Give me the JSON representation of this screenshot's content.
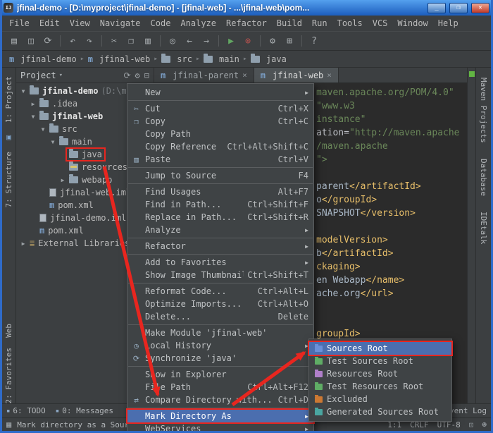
{
  "colors": {
    "selection": "#4b6eaf",
    "annotation_red": "#e8261f",
    "inspection_ok_green": "#62b543"
  },
  "window": {
    "title": "jfinal-demo - [D:\\myproject\\jfinal-demo] - [jfinal-web] - ...\\jfinal-web\\pom...",
    "app_icon": "IJ",
    "minimize": "_",
    "maximize": "❐",
    "close": "✕"
  },
  "menubar": {
    "items": [
      "File",
      "Edit",
      "View",
      "Navigate",
      "Code",
      "Analyze",
      "Refactor",
      "Build",
      "Run",
      "Tools",
      "VCS",
      "Window",
      "Help"
    ]
  },
  "toolbar": {
    "icons": [
      {
        "name": "open-icon",
        "glyph": "▤"
      },
      {
        "name": "save-all-icon",
        "glyph": "◫"
      },
      {
        "name": "synchronize-icon",
        "glyph": "⟳"
      },
      {
        "name": "sep"
      },
      {
        "name": "undo-icon",
        "glyph": "↶"
      },
      {
        "name": "redo-icon",
        "glyph": "↷"
      },
      {
        "name": "sep"
      },
      {
        "name": "cut-icon",
        "glyph": "✂"
      },
      {
        "name": "copy-icon",
        "glyph": "❐"
      },
      {
        "name": "paste-icon",
        "glyph": "▥"
      },
      {
        "name": "sep"
      },
      {
        "name": "find-icon",
        "glyph": "◎"
      },
      {
        "name": "back-icon",
        "glyph": "←"
      },
      {
        "name": "forward-icon",
        "glyph": "→"
      },
      {
        "name": "sep"
      },
      {
        "name": "run-icon",
        "glyph": "▶",
        "color": "#62a662"
      },
      {
        "name": "debug-icon",
        "glyph": "⊙",
        "color": "#c75450"
      },
      {
        "name": "sep"
      },
      {
        "name": "settings-icon",
        "glyph": "⚙"
      },
      {
        "name": "project-structure-icon",
        "glyph": "⊞"
      },
      {
        "name": "sep"
      },
      {
        "name": "help-icon",
        "glyph": "?"
      }
    ]
  },
  "breadcrumbs": {
    "separator": "▸",
    "items": [
      {
        "label": "jfinal-demo",
        "icon": "module"
      },
      {
        "label": "jfinal-web",
        "icon": "module"
      },
      {
        "label": "src",
        "icon": "folder"
      },
      {
        "label": "main",
        "icon": "folder"
      },
      {
        "label": "java",
        "icon": "folder"
      }
    ]
  },
  "left_strip": {
    "top": [
      {
        "label": "1: Project"
      },
      {
        "icon": "▣"
      },
      {
        "label": "7: Structure"
      }
    ],
    "bottom": [
      {
        "label": "Web"
      },
      {
        "label": "2: Favorites"
      }
    ]
  },
  "right_strip": {
    "items": [
      "Maven Projects",
      "Database",
      "IDEtalk"
    ]
  },
  "project_panel": {
    "title": "Project",
    "caret": "▾",
    "header_icons": [
      {
        "name": "sync-icon",
        "glyph": "⟳"
      },
      {
        "name": "gear-icon",
        "glyph": "⚙"
      },
      {
        "name": "collapse-all-icon",
        "glyph": "⊟"
      }
    ],
    "tree": [
      {
        "label": "jfinal-demo",
        "suffix": "(D:\\mypr",
        "depth": 0,
        "arrow": "open",
        "icon": "folder",
        "bold": true
      },
      {
        "label": ".idea",
        "depth": 1,
        "arrow": "closed",
        "icon": "folder"
      },
      {
        "label": "jfinal-web",
        "depth": 1,
        "arrow": "open",
        "icon": "folder",
        "bold": true
      },
      {
        "label": "src",
        "depth": 2,
        "arrow": "open",
        "icon": "folder"
      },
      {
        "label": "main",
        "depth": 3,
        "arrow": "open",
        "icon": "folder"
      },
      {
        "label": "java",
        "depth": 4,
        "icon": "folder",
        "boxed": true
      },
      {
        "label": "resources",
        "depth": 4,
        "icon": "folder-res"
      },
      {
        "label": "webapp",
        "depth": 4,
        "arrow": "closed",
        "icon": "folder"
      },
      {
        "label": "jfinal-web.iml",
        "depth": 2,
        "icon": "file"
      },
      {
        "label": "pom.xml",
        "depth": 2,
        "icon": "maven"
      },
      {
        "label": "jfinal-demo.iml",
        "depth": 1,
        "icon": "file"
      },
      {
        "label": "pom.xml",
        "depth": 1,
        "icon": "maven"
      },
      {
        "label": "External Libraries",
        "depth": 0,
        "arrow": "closed",
        "icon": "lib"
      }
    ]
  },
  "editor": {
    "tabs": [
      {
        "label": "jfinal-parent",
        "close": "×",
        "active": false
      },
      {
        "label": "jfinal-web",
        "close": "×",
        "active": true
      }
    ],
    "lines": [
      [
        {
          "t": "maven.apache.org/POM/4.0\"",
          "c": "str"
        }
      ],
      [
        {
          "t": "\"www.w3",
          "c": "str"
        }
      ],
      [
        {
          "t": "instance\"",
          "c": "str"
        }
      ],
      [
        {
          "t": "ation=",
          "c": "attr"
        },
        {
          "t": "\"http://maven.apache",
          "c": "str"
        }
      ],
      [
        {
          "t": "/maven.apache",
          "c": "str"
        }
      ],
      [
        {
          "t": "\">",
          "c": "str"
        }
      ],
      [],
      [
        {
          "t": "parent",
          "c": "txt"
        },
        {
          "t": "</artifactId>",
          "c": "tag"
        }
      ],
      [
        {
          "t": "o",
          "c": "txt"
        },
        {
          "t": "</groupId>",
          "c": "tag"
        }
      ],
      [
        {
          "t": "SNAPSHOT",
          "c": "txt"
        },
        {
          "t": "</version>",
          "c": "tag"
        }
      ],
      [],
      [
        {
          "t": "modelVersion>",
          "c": "tag"
        }
      ],
      [
        {
          "t": "b",
          "c": "txt"
        },
        {
          "t": "</artifactId>",
          "c": "tag"
        }
      ],
      [
        {
          "t": "ckaging>",
          "c": "tag"
        }
      ],
      [
        {
          "t": "en Webapp",
          "c": "txt"
        },
        {
          "t": "</name>",
          "c": "tag"
        }
      ],
      [
        {
          "t": "ache.org",
          "c": "txt"
        },
        {
          "t": "</url>",
          "c": "tag"
        }
      ],
      [],
      [],
      [
        {
          "t": "groupId>",
          "c": "tag"
        }
      ]
    ]
  },
  "context_menu": {
    "items": [
      {
        "label": "New",
        "arrow": true
      },
      {
        "sep": true
      },
      {
        "label": "Cut",
        "shortcut": "Ctrl+X",
        "icon": "cut"
      },
      {
        "label": "Copy",
        "shortcut": "Ctrl+C",
        "icon": "copy"
      },
      {
        "label": "Copy Path"
      },
      {
        "label": "Copy Reference",
        "shortcut": "Ctrl+Alt+Shift+C"
      },
      {
        "label": "Paste",
        "shortcut": "Ctrl+V",
        "icon": "paste"
      },
      {
        "sep": true
      },
      {
        "label": "Jump to Source",
        "shortcut": "F4"
      },
      {
        "sep": true
      },
      {
        "label": "Find Usages",
        "shortcut": "Alt+F7"
      },
      {
        "label": "Find in Path...",
        "shortcut": "Ctrl+Shift+F"
      },
      {
        "label": "Replace in Path...",
        "shortcut": "Ctrl+Shift+R"
      },
      {
        "label": "Analyze",
        "arrow": true
      },
      {
        "sep": true
      },
      {
        "label": "Refactor",
        "arrow": true
      },
      {
        "sep": true
      },
      {
        "label": "Add to Favorites",
        "arrow": true
      },
      {
        "label": "Show Image Thumbnails",
        "shortcut": "Ctrl+Shift+T"
      },
      {
        "sep": true
      },
      {
        "label": "Reformat Code...",
        "shortcut": "Ctrl+Alt+L"
      },
      {
        "label": "Optimize Imports...",
        "shortcut": "Ctrl+Alt+O"
      },
      {
        "label": "Delete...",
        "shortcut": "Delete"
      },
      {
        "sep": true
      },
      {
        "label": "Make Module 'jfinal-web'"
      },
      {
        "label": "Local History",
        "arrow": true,
        "icon": "history"
      },
      {
        "label": "Synchronize 'java'",
        "icon": "sync"
      },
      {
        "sep": true
      },
      {
        "label": "Show in Explorer"
      },
      {
        "label": "File Path",
        "shortcut": "Ctrl+Alt+F12"
      },
      {
        "label": "Compare Directory with...",
        "shortcut": "Ctrl+D",
        "icon": "compare"
      },
      {
        "sep": true
      },
      {
        "label": "Mark Directory As",
        "arrow": true,
        "selected": true,
        "boxed": true
      },
      {
        "label": "WebServices",
        "arrow": true
      }
    ]
  },
  "submenu": {
    "items": [
      {
        "label": "Sources Root",
        "color": "#6a8fd8",
        "selected": true,
        "boxed": true
      },
      {
        "label": "Test Sources Root",
        "color": "#5fad65"
      },
      {
        "label": "Resources Root",
        "color": "#b07fc9"
      },
      {
        "label": "Test Resources Root",
        "color": "#5fad65"
      },
      {
        "label": "Excluded",
        "color": "#cc7832"
      },
      {
        "label": "Generated Sources Root",
        "color": "#4aa6a0"
      }
    ]
  },
  "toolwindow_bar": {
    "left": [
      "6: TODO",
      "0: Messages"
    ],
    "right": [
      "Event Log"
    ]
  },
  "status_bar": {
    "message": "Mark directory as a Sources",
    "caret": "1:1",
    "line_sep": "CRLF",
    "encoding": "UTF-8"
  }
}
